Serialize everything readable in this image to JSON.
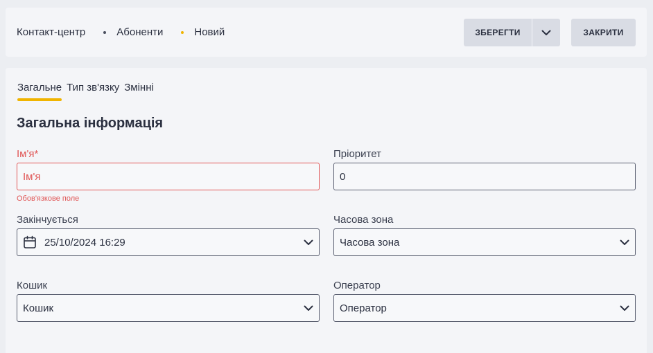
{
  "breadcrumb": {
    "items": [
      "Контакт-центр",
      "Абоненти",
      "Новий"
    ]
  },
  "toolbar": {
    "save_label": "ЗБЕРЕГТИ",
    "close_label": "ЗАКРИТИ"
  },
  "tabs": [
    {
      "label": "Загальне",
      "active": true
    },
    {
      "label": "Тип зв'язку",
      "active": false
    },
    {
      "label": "Змінні",
      "active": false
    }
  ],
  "section_title": "Загальна інформація",
  "form": {
    "name": {
      "label": "Ім'я*",
      "placeholder": "Ім'я",
      "error": "Обов'язкове поле"
    },
    "priority": {
      "label": "Пріоритет",
      "value": "0"
    },
    "ends": {
      "label": "Закінчується",
      "value": "25/10/2024 16:29"
    },
    "timezone": {
      "label": "Часова зона",
      "value": "Часова зона"
    },
    "bucket": {
      "label": "Кошик",
      "value": "Кошик"
    },
    "operator": {
      "label": "Оператор",
      "value": "Оператор"
    }
  },
  "colors": {
    "accent": "#f0b400",
    "error": "#e05555"
  }
}
